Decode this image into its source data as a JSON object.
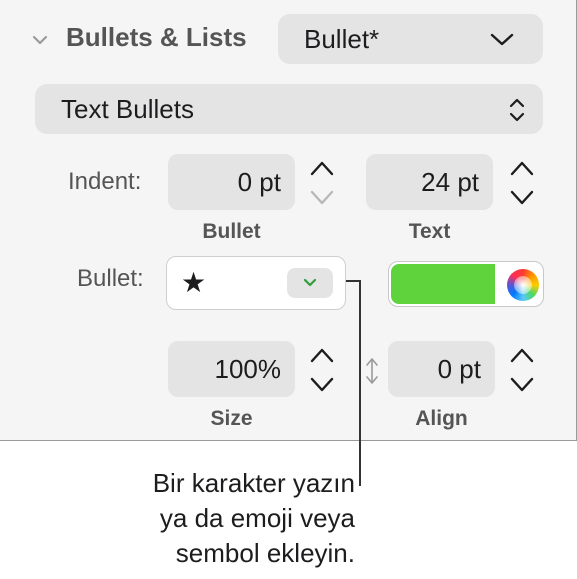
{
  "section": {
    "title": "Bullets & Lists",
    "style_value": "Bullet*",
    "type_value": "Text Bullets"
  },
  "indent": {
    "label": "Indent:",
    "bullet_value": "0 pt",
    "bullet_caption": "Bullet",
    "text_value": "24 pt",
    "text_caption": "Text"
  },
  "bullet": {
    "label": "Bullet:",
    "glyph": "★",
    "color": "#5ed33c"
  },
  "size_align": {
    "size_value": "100%",
    "size_caption": "Size",
    "align_value": "0 pt",
    "align_caption": "Align"
  },
  "callout": {
    "line1": "Bir karakter yazın",
    "line2": "ya da emoji veya",
    "line3": "sembol ekleyin."
  }
}
